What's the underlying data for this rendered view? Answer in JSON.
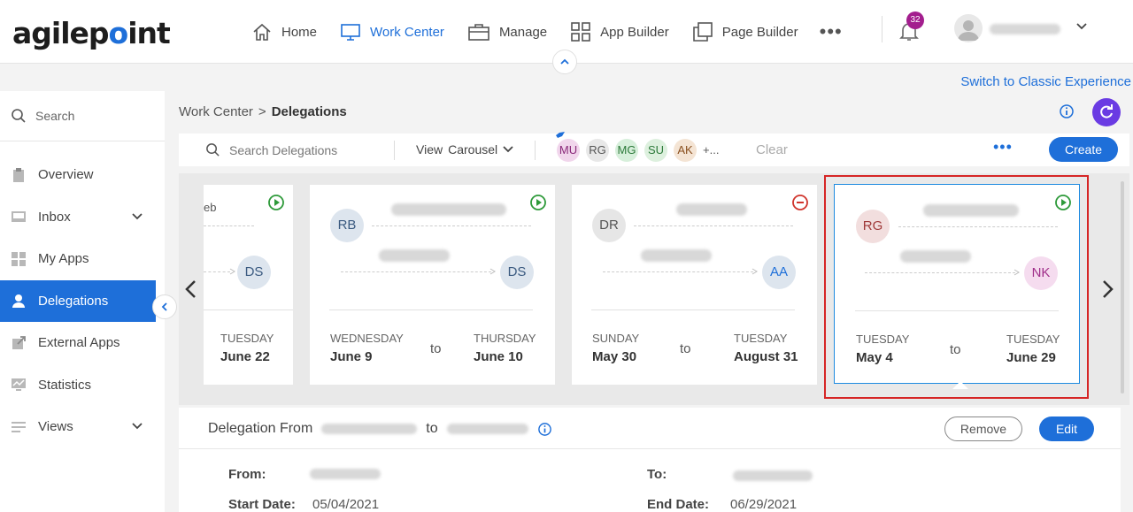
{
  "brand": {
    "logo_pre": "agilep",
    "logo_dot": "o",
    "logo_post": "int"
  },
  "nav": {
    "items": [
      {
        "label": "Home",
        "icon": "home-icon"
      },
      {
        "label": "Work Center",
        "icon": "monitor-icon",
        "active": true
      },
      {
        "label": "Manage",
        "icon": "briefcase-icon"
      },
      {
        "label": "App Builder",
        "icon": "grid-icon"
      },
      {
        "label": "Page Builder",
        "icon": "pages-icon"
      }
    ],
    "more": "•••",
    "notifications": "32"
  },
  "classic_link": "Switch to Classic Experience",
  "sidebar": {
    "search": "Search",
    "items": [
      {
        "label": "Overview"
      },
      {
        "label": "Inbox"
      },
      {
        "label": "My Apps"
      },
      {
        "label": "Delegations",
        "active": true
      },
      {
        "label": "External Apps"
      },
      {
        "label": "Statistics"
      },
      {
        "label": "Views"
      }
    ]
  },
  "breadcrumb": {
    "parent": "Work Center",
    "sep": ">",
    "current": "Delegations"
  },
  "toolbar": {
    "search_placeholder": "Search Delegations",
    "view_label": "View",
    "view_value": "Carousel",
    "chips": [
      "MU",
      "RG",
      "MG",
      "SU",
      "AK"
    ],
    "chip_more": "+...",
    "clear": "Clear",
    "more": "•••",
    "create": "Create"
  },
  "cards": [
    {
      "from_initials": "",
      "to_initials": "DS",
      "partial_text": "eb",
      "start_day": "",
      "start_date": "",
      "end_day": "TUESDAY",
      "end_date": "June 22",
      "status": "active"
    },
    {
      "from_initials": "RB",
      "to_initials": "DS",
      "start_day": "WEDNESDAY",
      "start_date": "June 9",
      "to": "to",
      "end_day": "THURSDAY",
      "end_date": "June 10",
      "status": "active"
    },
    {
      "from_initials": "DR",
      "to_initials": "AA",
      "start_day": "SUNDAY",
      "start_date": "May 30",
      "to": "to",
      "end_day": "TUESDAY",
      "end_date": "August 31",
      "status": "stopped"
    },
    {
      "from_initials": "RG",
      "to_initials": "NK",
      "start_day": "TUESDAY",
      "start_date": "May 4",
      "to": "to",
      "end_day": "TUESDAY",
      "end_date": "June 29",
      "status": "active"
    }
  ],
  "detail": {
    "title": "Delegation From",
    "to": "to",
    "remove": "Remove",
    "edit": "Edit",
    "from_label": "From:",
    "to_label": "To:",
    "start_label": "Start Date:",
    "start_value": "05/04/2021",
    "end_label": "End Date:",
    "end_value": "06/29/2021"
  },
  "colors": {
    "accent": "#1e6fd9",
    "play": "#2e9a3a",
    "stop": "#d0342c",
    "badge": "#a31e8e"
  }
}
